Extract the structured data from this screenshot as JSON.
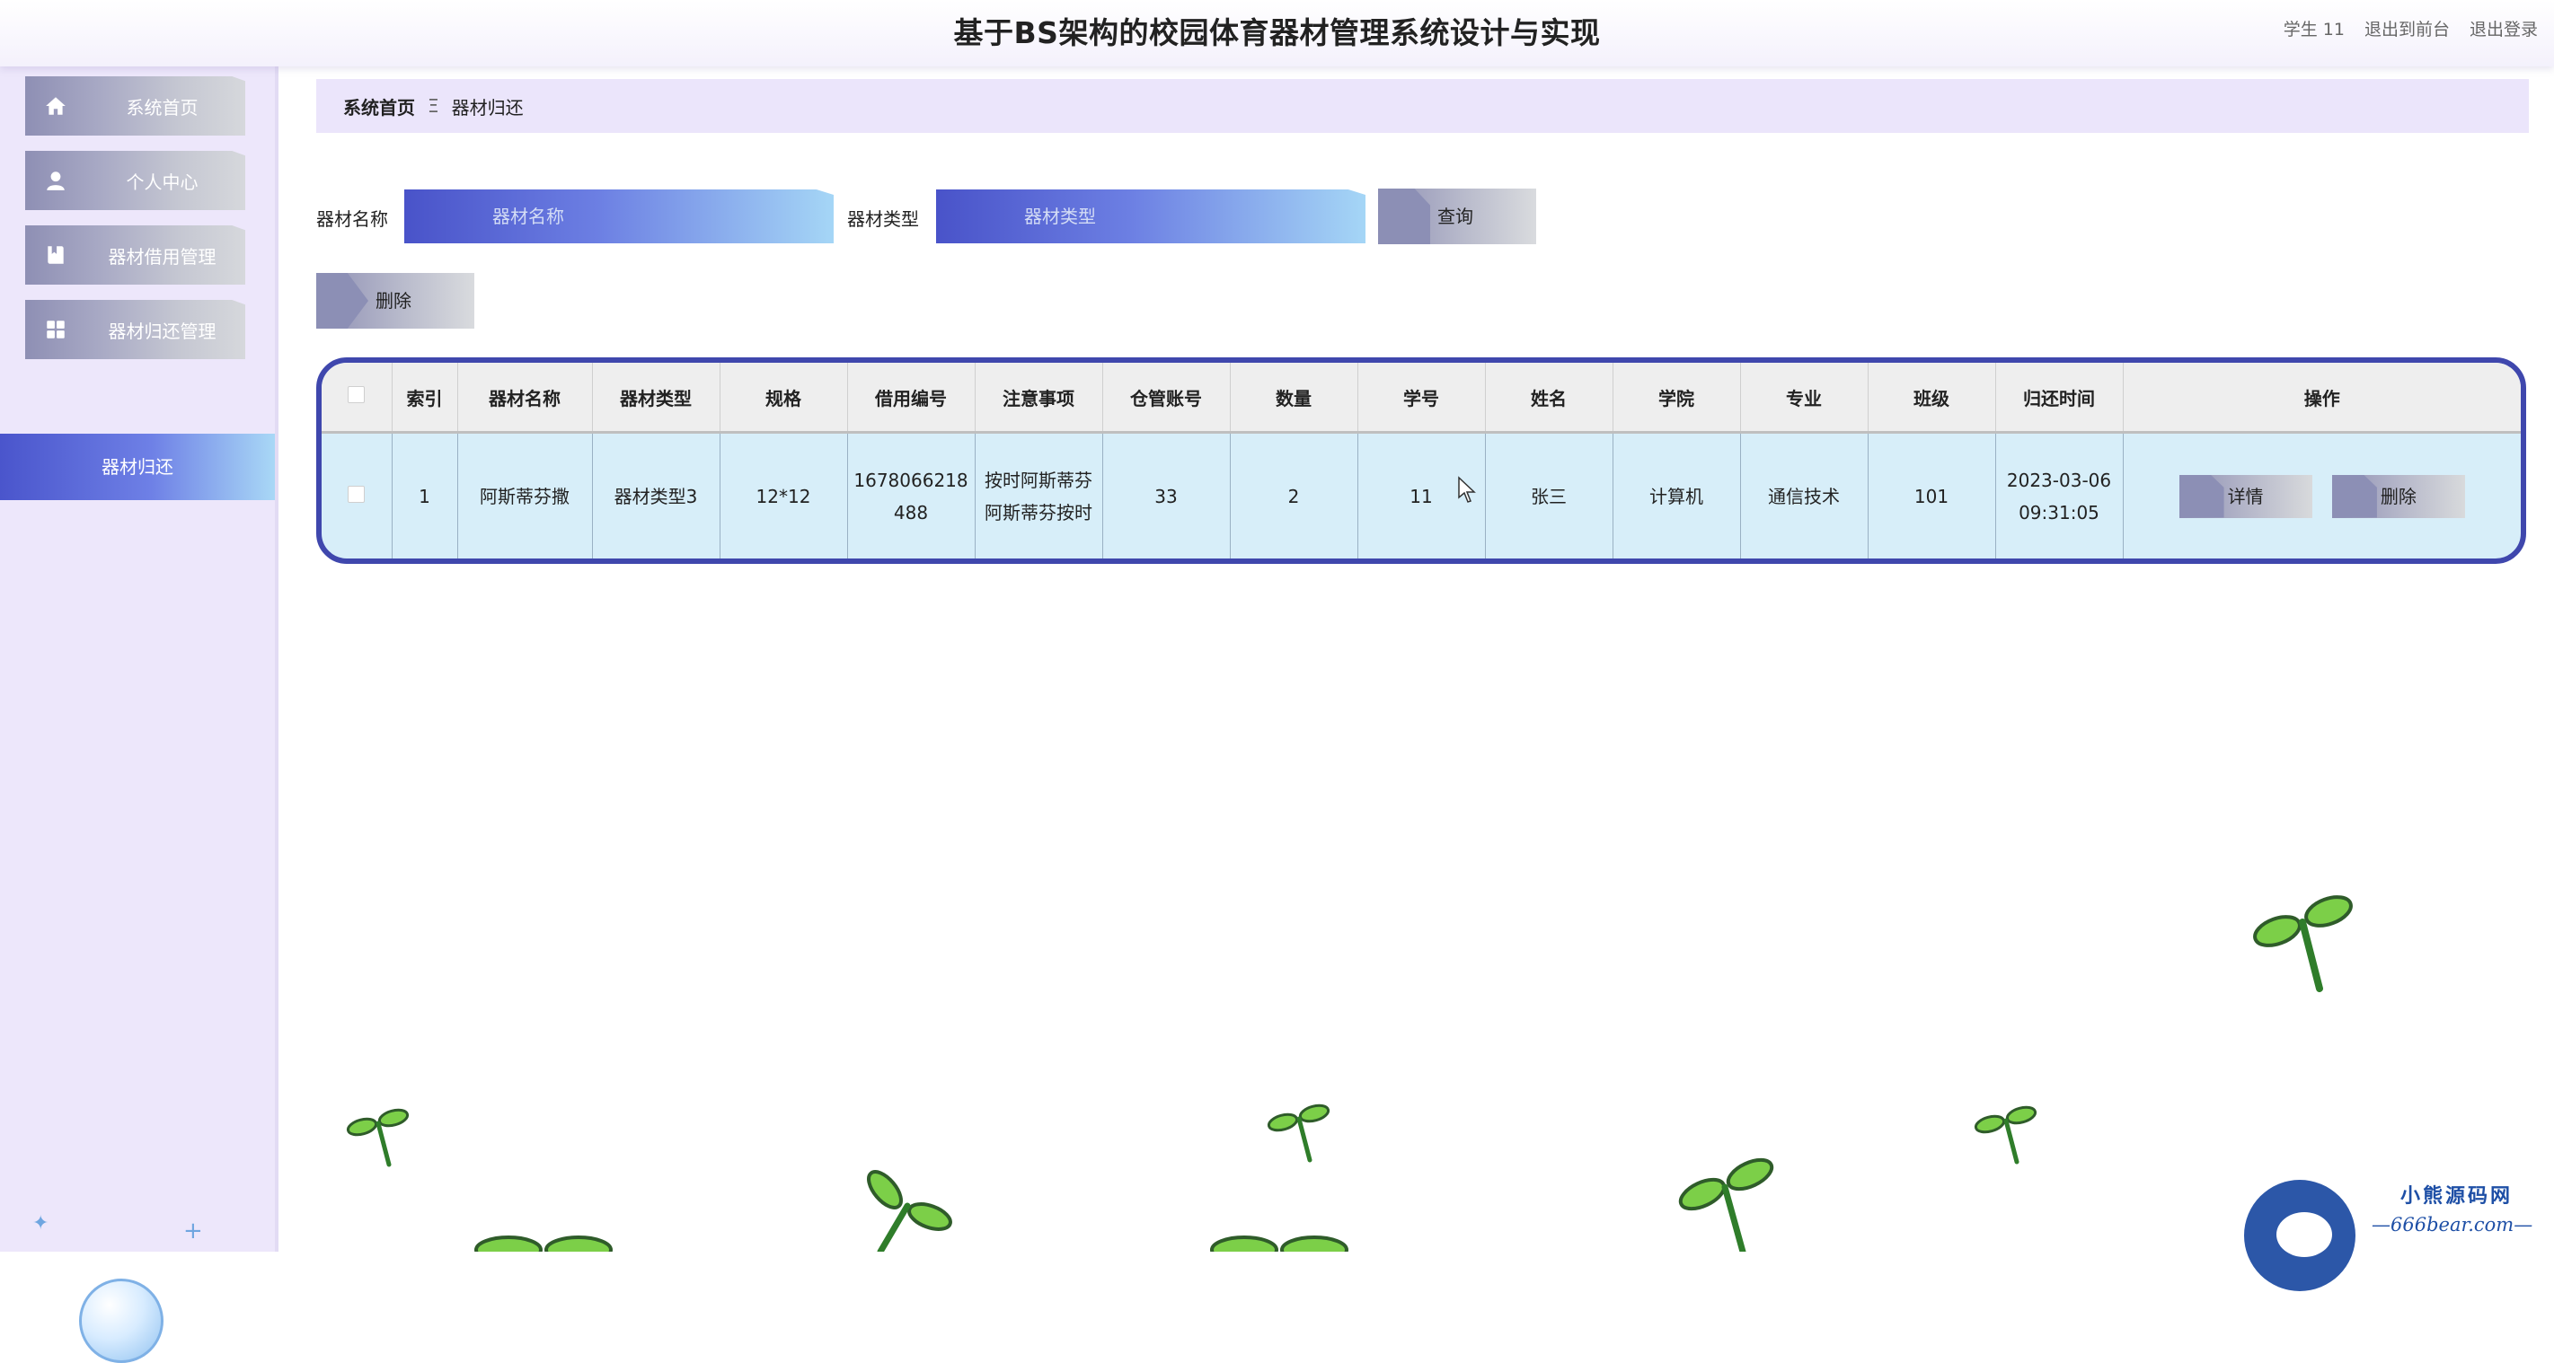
{
  "header": {
    "title": "基于BS架构的校园体育器材管理系统设计与实现",
    "user": "学生 11",
    "to_front": "退出到前台",
    "logout": "退出登录"
  },
  "sidebar": {
    "items": [
      {
        "label": "系统首页",
        "icon": "home-icon"
      },
      {
        "label": "个人中心",
        "icon": "user-icon"
      },
      {
        "label": "器材借用管理",
        "icon": "book-icon"
      },
      {
        "label": "器材归还管理",
        "icon": "grid-icon"
      }
    ],
    "sub_item": "器材归还"
  },
  "breadcrumb": {
    "home": "系统首页",
    "separator": "Ξ",
    "current": "器材归还"
  },
  "search": {
    "name_label": "器材名称",
    "name_placeholder": "器材名称",
    "type_label": "器材类型",
    "type_placeholder": "器材类型",
    "query_button": "查询"
  },
  "toolbar": {
    "delete_button": "删除"
  },
  "table": {
    "columns": [
      "索引",
      "器材名称",
      "器材类型",
      "规格",
      "借用编号",
      "注意事项",
      "仓管账号",
      "数量",
      "学号",
      "姓名",
      "学院",
      "专业",
      "班级",
      "归还时间",
      "操作"
    ],
    "rows": [
      {
        "index": "1",
        "name": "阿斯蒂芬撒",
        "type": "器材类型3",
        "spec": "12*12",
        "borrow_no": "1678066218488",
        "note": "按时阿斯蒂芬阿斯蒂芬按时",
        "keeper": "33",
        "quantity": "2",
        "student_no": "11",
        "student_name": "张三",
        "college": "计算机",
        "major": "通信技术",
        "class": "101",
        "return_time": "2023-03-06 09:31:05",
        "detail_button": "详情",
        "delete_button": "删除"
      }
    ]
  },
  "watermark": {
    "name": "小熊源码网",
    "url": "—666bear.com—"
  },
  "colors": {
    "accent": "#3f47ad",
    "sidebar_bg": "#ede7fb",
    "active_gradient_start": "#4a55cc",
    "row_bg": "#d7eef9",
    "leaf_green": "#7ccf48"
  }
}
